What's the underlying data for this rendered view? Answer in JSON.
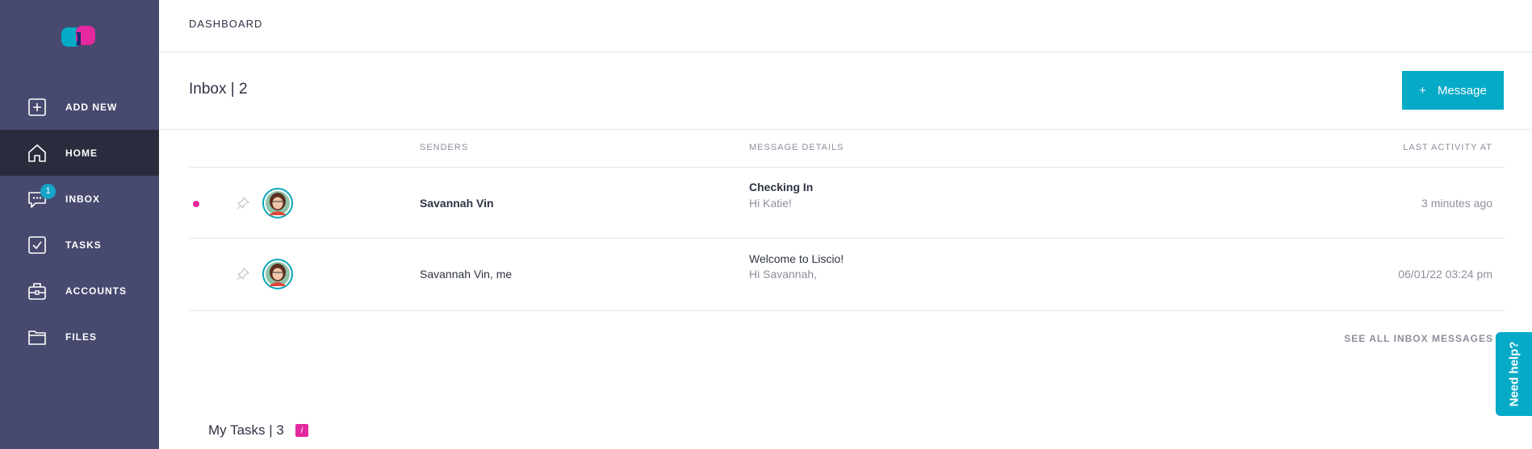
{
  "sidebar": {
    "items": [
      {
        "label": "ADD NEW",
        "icon": "plus-square-icon"
      },
      {
        "label": "HOME",
        "icon": "home-icon",
        "active": true
      },
      {
        "label": "INBOX",
        "icon": "chat-icon",
        "badge": "1"
      },
      {
        "label": "TASKS",
        "icon": "checkbox-icon"
      },
      {
        "label": "ACCOUNTS",
        "icon": "briefcase-icon"
      },
      {
        "label": "FILES",
        "icon": "folder-icon"
      }
    ]
  },
  "header": {
    "breadcrumb": "DASHBOARD"
  },
  "inbox": {
    "title": "Inbox | 2",
    "new_message_label": "Message",
    "columns": {
      "senders": "SENDERS",
      "details": "MESSAGE DETAILS",
      "last_activity": "LAST ACTIVITY AT"
    },
    "rows": [
      {
        "unread": true,
        "sender": "Savannah Vin",
        "subject": "Checking In",
        "preview": "Hi Katie!",
        "time": "3 minutes ago"
      },
      {
        "unread": false,
        "sender": "Savannah Vin, me",
        "subject": "Welcome to Liscio!",
        "preview": "Hi Savannah,",
        "time": "06/01/22 03:24 pm"
      }
    ],
    "see_all": "SEE ALL INBOX MESSAGES"
  },
  "tasks": {
    "title": "My Tasks | 3",
    "tag": "i"
  },
  "help": {
    "label": "Need help?"
  },
  "colors": {
    "sidebar": "#474a6e",
    "active": "#2a2b3c",
    "accent": "#05aac6",
    "unread": "#e4289d"
  }
}
